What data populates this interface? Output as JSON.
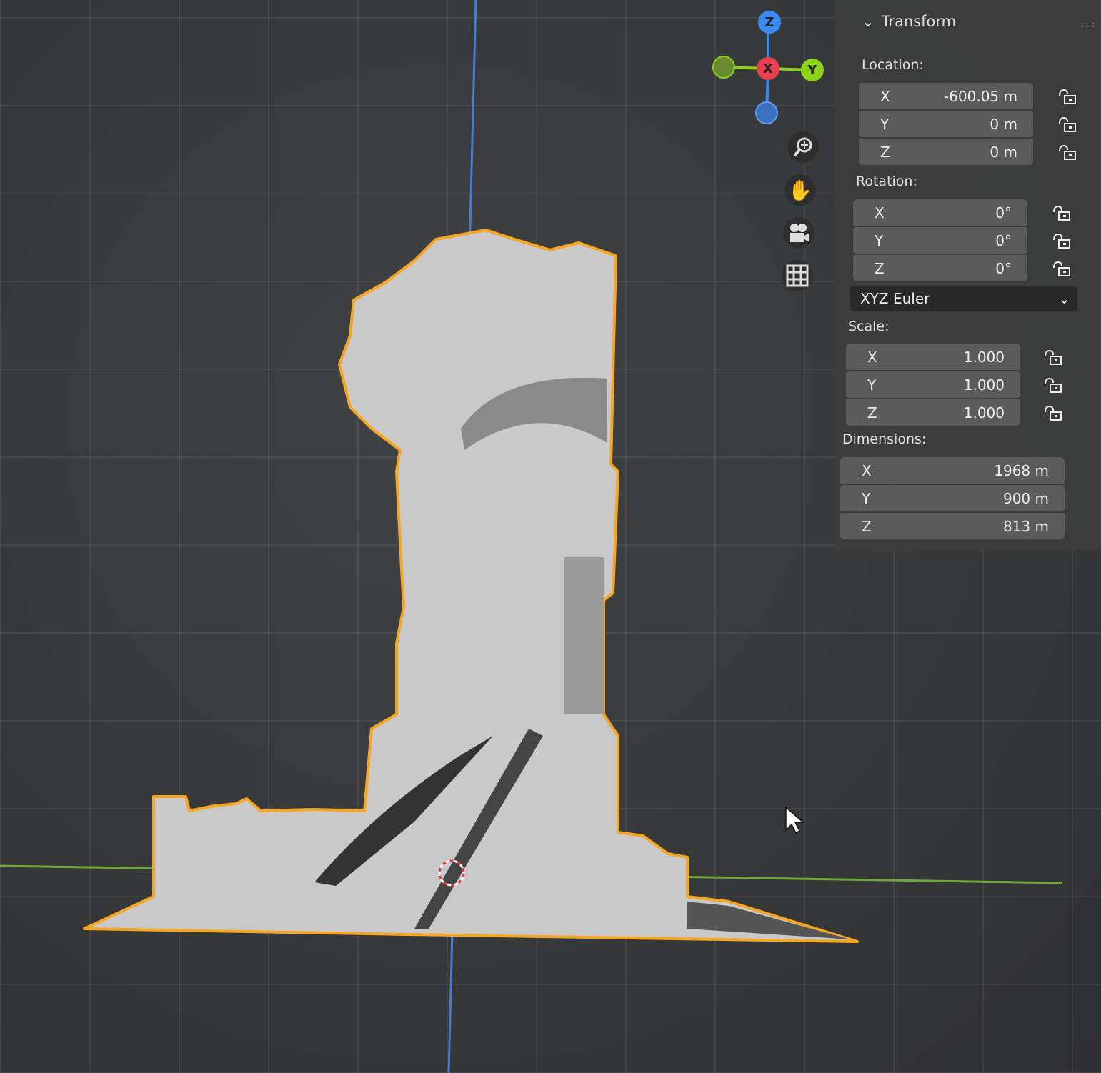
{
  "transform_panel": {
    "title": "Transform",
    "location": {
      "label": "Location:",
      "fields": [
        {
          "axis": "X",
          "value": "-600.05 m"
        },
        {
          "axis": "Y",
          "value": "0 m"
        },
        {
          "axis": "Z",
          "value": "0 m"
        }
      ]
    },
    "rotation": {
      "label": "Rotation:",
      "fields": [
        {
          "axis": "X",
          "value": "0°"
        },
        {
          "axis": "Y",
          "value": "0°"
        },
        {
          "axis": "Z",
          "value": "0°"
        }
      ]
    },
    "rotation_mode": "XYZ Euler",
    "scale": {
      "label": "Scale:",
      "fields": [
        {
          "axis": "X",
          "value": "1.000"
        },
        {
          "axis": "Y",
          "value": "1.000"
        },
        {
          "axis": "Z",
          "value": "1.000"
        }
      ]
    },
    "dimensions": {
      "label": "Dimensions:",
      "fields": [
        {
          "axis": "X",
          "value": "1968 m"
        },
        {
          "axis": "Y",
          "value": "900 m"
        },
        {
          "axis": "Z",
          "value": "813 m"
        }
      ]
    }
  },
  "gizmo": {
    "z": "Z",
    "x": "X",
    "y": "Y",
    "colors": {
      "x": "#e8404f",
      "y": "#8bd41b",
      "z": "#3b8cf0",
      "selection": "#f5a623"
    }
  },
  "nav_tools": [
    "zoom-icon",
    "hand-pan-icon",
    "camera-icon",
    "grid-ortho-icon"
  ]
}
